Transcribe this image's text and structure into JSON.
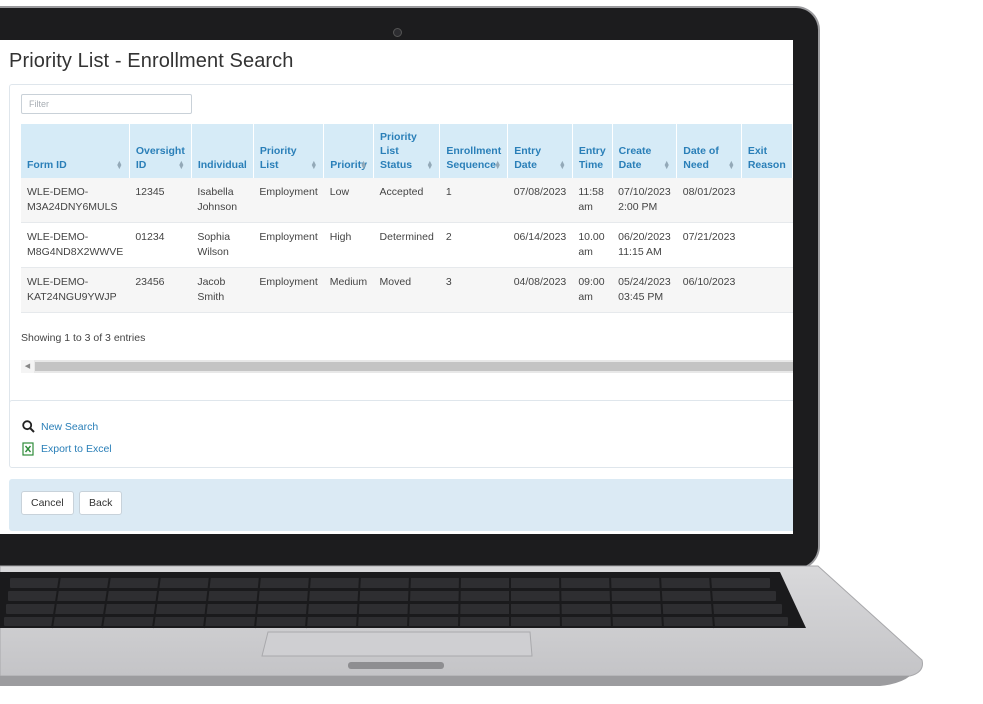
{
  "page": {
    "title": "Priority List - Enrollment Search"
  },
  "filter": {
    "placeholder": "Filter"
  },
  "table": {
    "columns": [
      "Form ID",
      "Oversight ID",
      "Individual",
      "Priority List",
      "Priority",
      "Priority List Status",
      "Enrollment Sequence",
      "Entry Date",
      "Entry Time",
      "Create Date",
      "Date of Need",
      "Exit Reason"
    ],
    "rows": [
      [
        "WLE-DEMO-M3A24DNY6MULS",
        "12345",
        "Isabella Johnson",
        "Employment",
        "Low",
        "Accepted",
        "1",
        "07/08/2023",
        "11:58 am",
        "07/10/2023 2:00 PM",
        "08/01/2023",
        ""
      ],
      [
        "WLE-DEMO-M8G4ND8X2WWVE",
        "01234",
        "Sophia Wilson",
        "Employment",
        "High",
        "Determined",
        "2",
        "06/14/2023",
        "10.00 am",
        "06/20/2023 11:15 AM",
        "07/21/2023",
        ""
      ],
      [
        "WLE-DEMO-KAT24NGU9YWJP",
        "23456",
        "Jacob Smith",
        "Employment",
        "Medium",
        "Moved",
        "3",
        "04/08/2023",
        "09:00 am",
        "05/24/2023 03:45 PM",
        "06/10/2023",
        ""
      ]
    ]
  },
  "table_info": "Showing 1 to 3 of 3 entries",
  "actions": {
    "new_search": "New Search",
    "export_excel": "Export to Excel"
  },
  "footer": {
    "cancel": "Cancel",
    "back": "Back"
  },
  "icons": [
    "search-icon",
    "excel-icon",
    "sort-icon"
  ],
  "colors": {
    "header_bg": "#d6ebf7",
    "header_text": "#2a7fb8",
    "link": "#2a7fb8",
    "footer_bg": "#dbeaf4"
  }
}
